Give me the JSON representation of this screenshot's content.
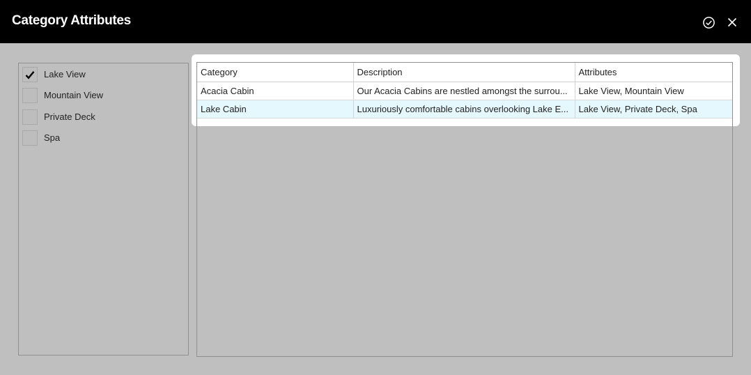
{
  "header": {
    "title": "Category Attributes",
    "confirm_icon": "check-circle-icon",
    "close_icon": "close-icon"
  },
  "attributes": [
    {
      "label": "Lake View",
      "checked": true
    },
    {
      "label": "Mountain View",
      "checked": false
    },
    {
      "label": "Private Deck",
      "checked": false
    },
    {
      "label": "Spa",
      "checked": false
    }
  ],
  "table": {
    "columns": [
      "Category",
      "Description",
      "Attributes"
    ],
    "rows": [
      {
        "category": "Acacia Cabin",
        "description": "Our Acacia Cabins are nestled amongst the surrou...",
        "attributes": "Lake View, Mountain View",
        "selected": false
      },
      {
        "category": "Lake Cabin",
        "description": "Luxuriously comfortable cabins overlooking Lake E...",
        "attributes": "Lake View, Private Deck, Spa",
        "selected": true
      }
    ]
  }
}
